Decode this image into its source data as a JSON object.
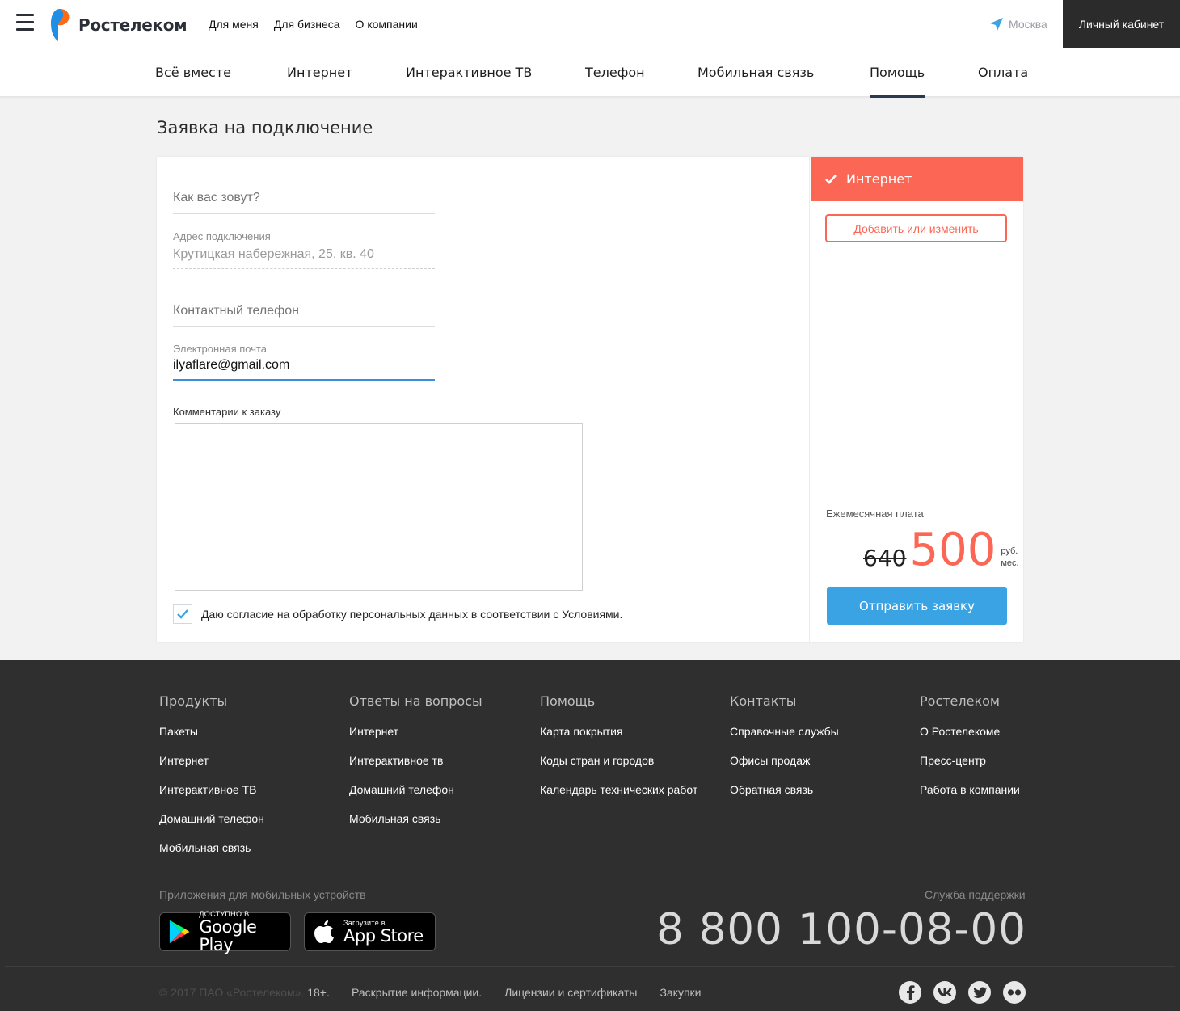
{
  "header": {
    "brand": "Ростелеком",
    "top_links": [
      "Для меня",
      "Для бизнеса",
      "О компании"
    ],
    "city": "Москва",
    "cabinet_label": "Личный кабинет"
  },
  "main_nav": {
    "items": [
      "Всё вместе",
      "Интернет",
      "Интерактивное ТВ",
      "Телефон",
      "Мобильная связь",
      "Помощь",
      "Оплата"
    ],
    "active": "Помощь"
  },
  "page_title": "Заявка на подключение",
  "form": {
    "name_placeholder": "Как вас зовут?",
    "address_label": "Адрес подключения",
    "address_value": "Крутицкая набережная, 25, кв. 40",
    "phone_placeholder": "Контактный телефон",
    "email_label": "Электронная почта",
    "email_value": "ilyaflare@gmail.com",
    "comment_label": "Комментарии к заказу",
    "comment_value": "",
    "consent_text": "Даю согласие на обработку персональных данных в соответствии с Условиями.",
    "consent_checked": true
  },
  "order": {
    "service_name": "Интернет",
    "change_button": "Добавить или изменить",
    "monthly_fee_label": "Ежемесячная плата",
    "old_price": "640",
    "new_price": "500",
    "unit_line1": "руб.",
    "unit_line2": "мес.",
    "submit_button": "Отправить заявку"
  },
  "footer": {
    "columns": [
      {
        "title": "Продукты",
        "links": [
          "Пакеты",
          "Интернет",
          "Интерактивное ТВ",
          "Домашний телефон",
          "Мобильная связь"
        ]
      },
      {
        "title": "Ответы на вопросы",
        "links": [
          "Интернет",
          "Интерактивное тв",
          "Домашний телефон",
          "Мобильная связь"
        ]
      },
      {
        "title": "Помощь",
        "links": [
          "Карта покрытия",
          "Коды стран и городов",
          "Календарь технических работ"
        ]
      },
      {
        "title": "Контакты",
        "links": [
          "Справочные службы",
          "Офисы продаж",
          "Обратная связь"
        ]
      },
      {
        "title": "Ростелеком",
        "links": [
          "О Ростелекоме",
          "Пресс-центр",
          "Работа в компании"
        ]
      }
    ],
    "apps_label": "Приложения для мобильных устройств",
    "google_play": {
      "line1": "ДОСТУПНО В",
      "line2": "Google Play"
    },
    "app_store": {
      "line1": "Загрузите в",
      "line2": "App Store"
    },
    "support_label": "Служба поддержки",
    "support_phone": "8 800 100-08-00",
    "copyright": "© 2017 ПАО «Ростелеком».",
    "age": "18+.",
    "bottom_links": [
      "Раскрытие информации.",
      "Лицензии и сертификаты",
      "Закупки"
    ],
    "social_icons": [
      "facebook-icon",
      "vk-icon",
      "twitter-icon",
      "flickr-icon"
    ]
  },
  "colors": {
    "accent": "#fc6654",
    "primary_button": "#3aa3e3",
    "dark": "#2b2b2b",
    "footer_bg": "#2f2f2f"
  }
}
